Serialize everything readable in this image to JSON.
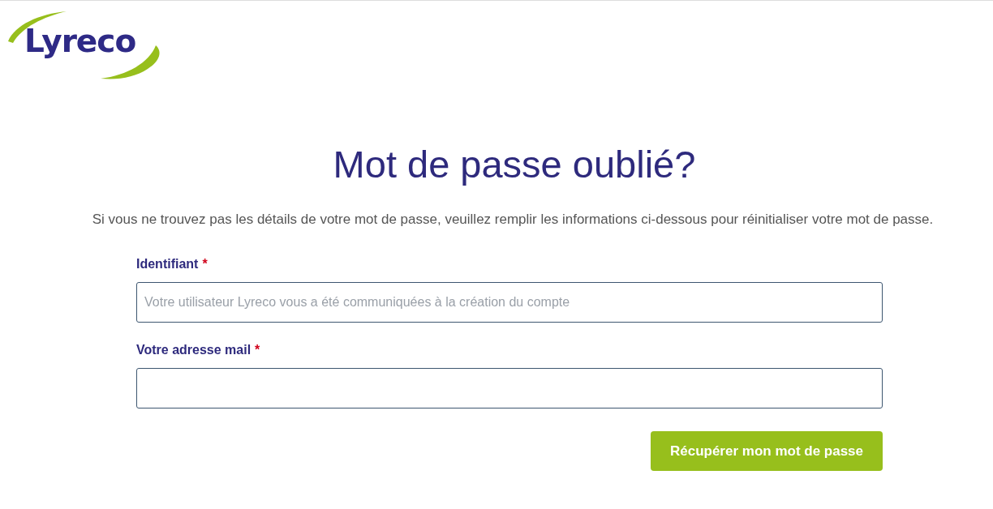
{
  "logo": {
    "text": "Lyreco"
  },
  "title": "Mot de passe oublié?",
  "description": "Si vous ne trouvez pas les détails de votre mot de passe, veuillez remplir les informations ci-dessous pour réinitialiser votre mot de passe.",
  "fields": [
    {
      "label": "Identifiant",
      "required": true,
      "required_mark": "*",
      "placeholder": "Votre utilisateur Lyreco vous a été communiquées à la création du compte"
    },
    {
      "label": "Votre adresse mail",
      "required": true,
      "required_mark": "*"
    }
  ],
  "submit_button": "Récupérer mon mot de passe"
}
